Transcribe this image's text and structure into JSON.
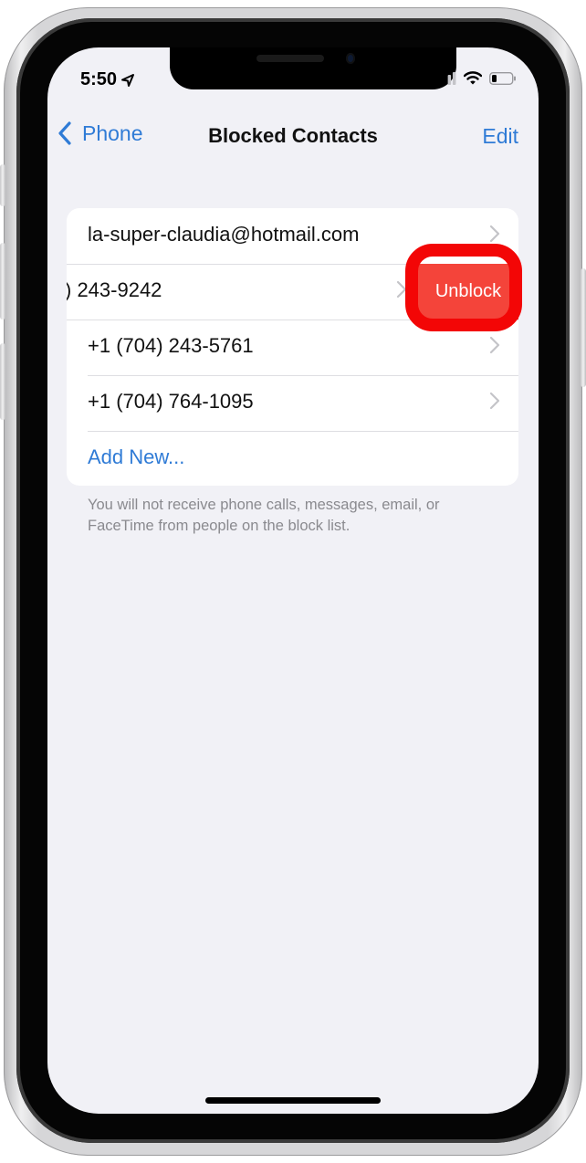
{
  "status_bar": {
    "time": "5:50",
    "location_icon": "location-arrow-icon",
    "signal_icon": "cellular-signal-icon",
    "wifi_icon": "wifi-icon",
    "battery_icon": "battery-low-icon"
  },
  "navbar": {
    "back_label": "Phone",
    "back_icon": "chevron-left-icon",
    "title": "Blocked Contacts",
    "edit_label": "Edit"
  },
  "blocked_list": {
    "items": [
      {
        "label": "la-super-claudia@hotmail.com"
      },
      {
        "label": ") 243-9242",
        "swiped": true,
        "action_label": "Unblock"
      },
      {
        "label": "+1 (704) 243-5761"
      },
      {
        "label": "+1 (704) 764-1095"
      }
    ],
    "add_new_label": "Add New...",
    "footer_text": "You will not receive phone calls, messages, email, or FaceTime from people on the block list."
  },
  "colors": {
    "accent": "#2f7bd6",
    "destructive": "#f4443a",
    "highlight_ring": "#f30606",
    "background": "#f1f1f6"
  }
}
